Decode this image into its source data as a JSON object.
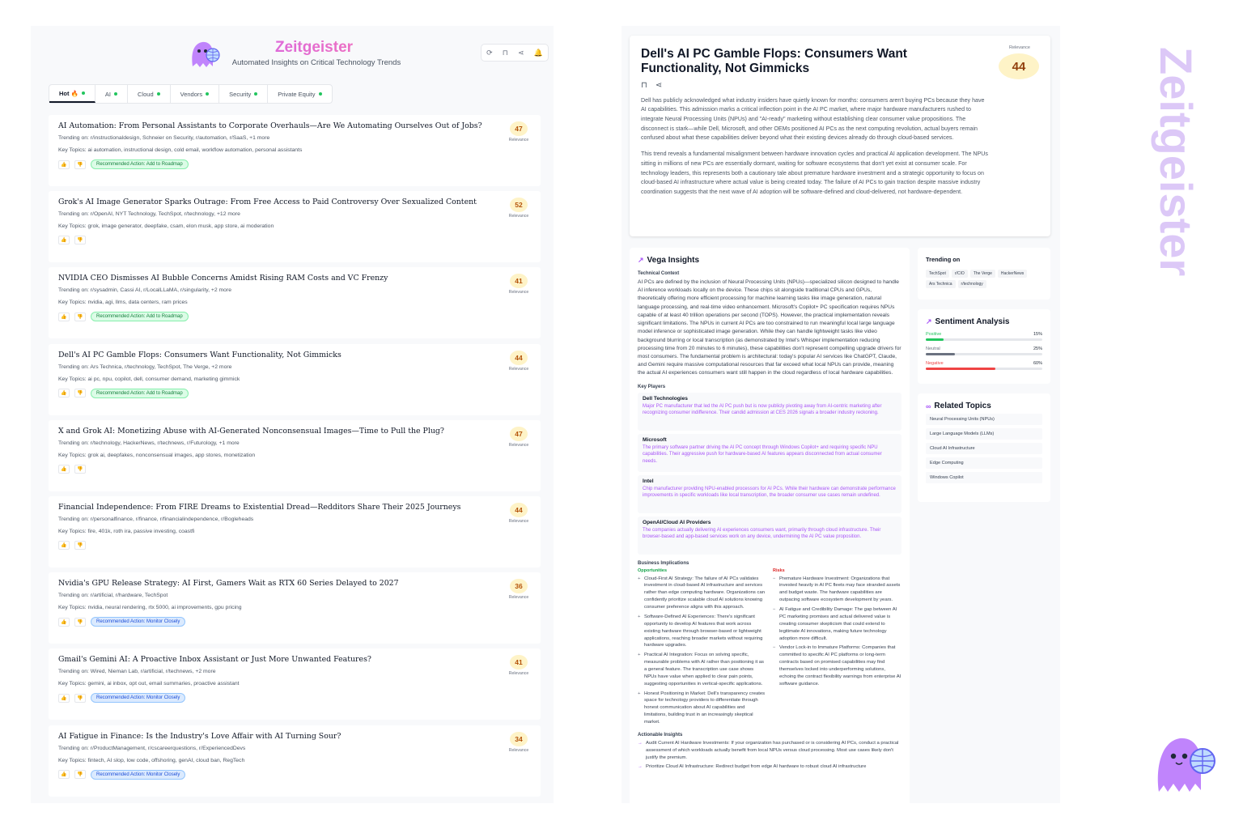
{
  "brand": {
    "title": "Zeitgeister",
    "subtitle": "Automated Insights on Critical Technology Trends"
  },
  "top_actions": [
    {
      "name": "refresh-icon",
      "glyph": "⟳"
    },
    {
      "name": "bookmark-icon",
      "glyph": "⊓"
    },
    {
      "name": "share-icon",
      "glyph": "⋖"
    },
    {
      "name": "bell-icon",
      "glyph": "🔔"
    }
  ],
  "tabs": [
    {
      "label": "Hot 🔥",
      "active": true
    },
    {
      "label": "AI",
      "active": false
    },
    {
      "label": "Cloud",
      "active": false
    },
    {
      "label": "Vendors",
      "active": false
    },
    {
      "label": "Security",
      "active": false
    },
    {
      "label": "Private Equity",
      "active": false
    }
  ],
  "relevance_label": "Relevance",
  "trending_prefix": "Trending on:",
  "topics_prefix": "Key Topics:",
  "colors": {
    "accent": "#a855f7",
    "positive": "#22c55e",
    "neutral": "#6b7280",
    "negative": "#ef4444"
  },
  "cards": [
    {
      "title": "AI Automation: From Personal Assistants to Corporate Overhauls—Are We Automating Ourselves Out of Jobs?",
      "trending": "r/instructionaldesign, Schneier on Security, r/automation, r/SaaS, +1 more",
      "topics": "ai automation, instructional design, cold email, workflow automation, personal assistants",
      "relevance": "47",
      "action": "Recommended Action: Add to Roadmap",
      "action_type": "roadmap"
    },
    {
      "title": "Grok's AI Image Generator Sparks Outrage: From Free Access to Paid Controversy Over Sexualized Content",
      "trending": "r/OpenAI, NYT Technology, TechSpot, r/technology, +12 more",
      "topics": "grok, image generator, deepfake, csam, elon musk, app store, ai moderation",
      "relevance": "52",
      "action": "",
      "action_type": ""
    },
    {
      "title": "NVIDIA CEO Dismisses AI Bubble Concerns Amidst Rising RAM Costs and VC Frenzy",
      "trending": "r/sysadmin, Cassi AI, r/LocalLLaMA, r/singularity, +2 more",
      "topics": "nvidia, agi, llms, data centers, ram prices",
      "relevance": "41",
      "action": "Recommended Action: Add to Roadmap",
      "action_type": "roadmap"
    },
    {
      "title": "Dell's AI PC Gamble Flops: Consumers Want Functionality, Not Gimmicks",
      "trending": "Ars Technica, r/technology, TechSpot, The Verge, +2 more",
      "topics": "ai pc, npu, copilot, dell, consumer demand, marketing gimmick",
      "relevance": "44",
      "action": "Recommended Action: Add to Roadmap",
      "action_type": "roadmap"
    },
    {
      "title": "X and Grok AI: Monetizing Abuse with AI-Generated Nonconsensual Images—Time to Pull the Plug?",
      "trending": "r/technology, HackerNews, r/technews, r/Futurology, +1 more",
      "topics": "grok ai, deepfakes, nonconsensual images, app stores, monetization",
      "relevance": "47",
      "action": "",
      "action_type": ""
    },
    {
      "title": "Financial Independence: From FIRE Dreams to Existential Dread—Redditors Share Their 2025 Journeys",
      "trending": "r/personalfinance, r/finance, r/financialindependence, r/Bogleheads",
      "topics": "fire, 401k, roth ira, passive investing, coastfi",
      "relevance": "44",
      "action": "",
      "action_type": ""
    },
    {
      "title": "Nvidia's GPU Release Strategy: AI First, Gamers Wait as RTX 60 Series Delayed to 2027",
      "trending": "r/artificial, r/hardware, TechSpot",
      "topics": "nvidia, neural rendering, rtx 5000, ai improvements, gpu pricing",
      "relevance": "36",
      "action": "Recommended Action: Monitor Closely",
      "action_type": "monitor"
    },
    {
      "title": "Gmail's Gemini AI: A Proactive Inbox Assistant or Just More Unwanted Features?",
      "trending": "Wired, Nieman Lab, r/artificial, r/technews, +2 more",
      "topics": "gemini, ai inbox, opt out, email summaries, proactive assistant",
      "relevance": "41",
      "action": "Recommended Action: Monitor Closely",
      "action_type": "monitor"
    },
    {
      "title": "AI Fatigue in Finance: Is the Industry's Love Affair with AI Turning Sour?",
      "trending": "r/ProductManagement, r/cscareerquestions, r/ExperiencedDevs",
      "topics": "fintech, AI slop, low code, offshoring, genAI, cloud ban, RegTech",
      "relevance": "34",
      "action": "Recommended Action: Monitor Closely",
      "action_type": "monitor"
    }
  ],
  "article": {
    "title": "Dell's AI PC Gamble Flops: Consumers Want Functionality, Not Gimmicks",
    "relevance_label": "Relevance",
    "relevance": "44",
    "paragraphs": [
      "Dell has publicly acknowledged what industry insiders have quietly known for months: consumers aren't buying PCs because they have AI capabilities. This admission marks a critical inflection point in the AI PC market, where major hardware manufacturers rushed to integrate Neural Processing Units (NPUs) and \"AI-ready\" marketing without establishing clear consumer value propositions. The disconnect is stark—while Dell, Microsoft, and other OEMs positioned AI PCs as the next computing revolution, actual buyers remain confused about what these capabilities deliver beyond what their existing devices already do through cloud-based services.",
      "This trend reveals a fundamental misalignment between hardware innovation cycles and practical AI application development. The NPUs sitting in millions of new PCs are essentially dormant, waiting for software ecosystems that don't yet exist at consumer scale. For technology leaders, this represents both a cautionary tale about premature hardware investment and a strategic opportunity to focus on cloud-based AI infrastructure where actual value is being created today. The failure of AI PCs to gain traction despite massive industry coordination suggests that the next wave of AI adoption will be software-defined and cloud-delivered, not hardware-dependent."
    ]
  },
  "insights": {
    "heading": "Vega Insights",
    "technical_context_label": "Technical Context",
    "technical_context": "AI PCs are defined by the inclusion of Neural Processing Units (NPUs)—specialized silicon designed to handle AI inference workloads locally on the device. These chips sit alongside traditional CPUs and GPUs, theoretically offering more efficient processing for machine learning tasks like image generation, natural language processing, and real-time video enhancement. Microsoft's Copilot+ PC specification requires NPUs capable of at least 40 trillion operations per second (TOPS). However, the practical implementation reveals significant limitations. The NPUs in current AI PCs are too constrained to run meaningful local large language model inference or sophisticated image generation. While they can handle lightweight tasks like video background blurring or local transcription (as demonstrated by Intel's Whisper implementation reducing processing time from 20 minutes to 6 minutes), these capabilities don't represent compelling upgrade drivers for most consumers. The fundamental problem is architectural: today's popular AI services like ChatGPT, Claude, and Gemini require massive computational resources that far exceed what local NPUs can provide, meaning the actual AI experiences consumers want still happen in the cloud regardless of local hardware capabilities.",
    "key_players_label": "Key Players",
    "players": [
      {
        "name": "Dell Technologies",
        "desc": "Major PC manufacturer that led the AI PC push but is now publicly pivoting away from AI-centric marketing after recognizing consumer indifference. Their candid admission at CES 2026 signals a broader industry reckoning."
      },
      {
        "name": "Microsoft",
        "desc": "The primary software partner driving the AI PC concept through Windows Copilot+ and requiring specific NPU capabilities. Their aggressive push for hardware-based AI features appears disconnected from actual consumer needs."
      },
      {
        "name": "Intel",
        "desc": "Chip manufacturer providing NPU-enabled processors for AI PCs. While their hardware can demonstrate performance improvements in specific workloads like local transcription, the broader consumer use cases remain undefined."
      },
      {
        "name": "OpenAI/Cloud AI Providers",
        "desc": "The companies actually delivering AI experiences consumers want, primarily through cloud infrastructure. Their browser-based and app-based services work on any device, undermining the AI PC value proposition."
      }
    ],
    "business_label": "Business Implications",
    "opportunities_label": "Opportunities",
    "risks_label": "Risks",
    "opportunities": [
      "Cloud-First AI Strategy: The failure of AI PCs validates investment in cloud-based AI infrastructure and services rather than edge computing hardware. Organizations can confidently prioritize scalable cloud AI solutions knowing consumer preference aligns with this approach.",
      "Software-Defined AI Experiences: There's significant opportunity to develop AI features that work across existing hardware through browser-based or lightweight applications, reaching broader markets without requiring hardware upgrades.",
      "Practical AI Integration: Focus on solving specific, measurable problems with AI rather than positioning it as a general feature. The transcription use case shows NPUs have value when applied to clear pain points, suggesting opportunities in vertical-specific applications.",
      "Honest Positioning in Market: Dell's transparency creates space for technology providers to differentiate through honest communication about AI capabilities and limitations, building trust in an increasingly skeptical market."
    ],
    "risks": [
      "Premature Hardware Investment: Organizations that invested heavily in AI PC fleets may face stranded assets and budget waste. The hardware capabilities are outpacing software ecosystem development by years.",
      "AI Fatigue and Credibility Damage: The gap between AI PC marketing promises and actual delivered value is creating consumer skepticism that could extend to legitimate AI innovations, making future technology adoption more difficult.",
      "Vendor Lock-in to Immature Platforms: Companies that committed to specific AI PC platforms or long-term contracts based on promised capabilities may find themselves locked into underperforming solutions, echoing the contract flexibility warnings from enterprise AI software guidance."
    ],
    "actionable_label": "Actionable Insights",
    "actionable": [
      "Audit Current AI Hardware Investments: If your organization has purchased or is considering AI PCs, conduct a practical assessment of which workloads actually benefit from local NPUs versus cloud processing. Most use cases likely don't justify the premium.",
      "Prioritize Cloud AI Infrastructure: Redirect budget from edge AI hardware to robust cloud AI infrastructure"
    ]
  },
  "trending": {
    "heading": "Trending on",
    "sources": [
      "TechSpot",
      "r/CIO",
      "The Verge",
      "HackerNews",
      "Ars Technica",
      "r/technology"
    ]
  },
  "sentiment": {
    "heading": "Sentiment Analysis",
    "rows": [
      {
        "label": "Positive",
        "value": "15%",
        "fraction": 0.15,
        "color": "#22c55e"
      },
      {
        "label": "Neutral",
        "value": "25%",
        "fraction": 0.25,
        "color": "#6b7280"
      },
      {
        "label": "Negative",
        "value": "60%",
        "fraction": 0.6,
        "color": "#ef4444"
      }
    ]
  },
  "related": {
    "heading": "Related Topics",
    "items": [
      "Neural Processing Units (NPUs)",
      "Large Language Models (LLMs)",
      "Cloud AI Infrastructure",
      "Edge Computing",
      "Windows Copilot"
    ]
  },
  "vertical_brand": "Zeitgeister"
}
